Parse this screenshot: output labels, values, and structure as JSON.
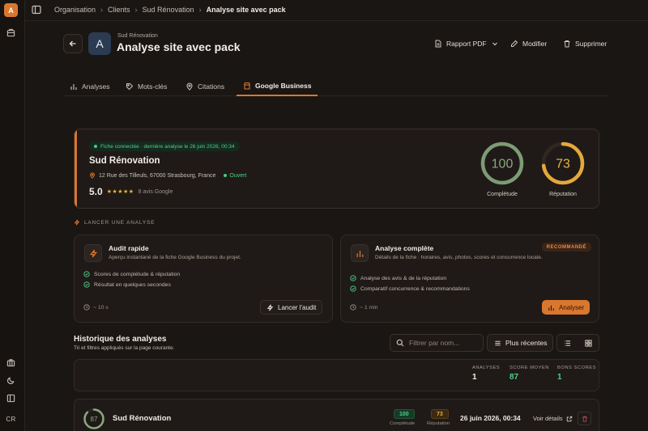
{
  "app": {
    "logo_letter": "A",
    "user_initials": "CR"
  },
  "breadcrumb": {
    "items": [
      "Organisation",
      "Clients",
      "Sud Rénovation",
      "Analyse site avec pack"
    ]
  },
  "header": {
    "avatar_letter": "A",
    "client": "Sud Rénovation",
    "title": "Analyse site avec pack",
    "pdf_label": "Rapport PDF",
    "edit_label": "Modifier",
    "delete_label": "Supprimer"
  },
  "tabs": [
    {
      "label": "Analyses",
      "icon": "bar-chart-icon"
    },
    {
      "label": "Mots-clés",
      "icon": "tag-icon"
    },
    {
      "label": "Citations",
      "icon": "map-pin-icon"
    },
    {
      "label": "Google Business",
      "icon": "store-icon",
      "active": true
    }
  ],
  "business": {
    "status": "Fiche connectée · dernière analyse le 26 juin 2026, 00:34",
    "name": "Sud Rénovation",
    "address": "12 Rue des Tilleuls, 67000 Strasbourg, France",
    "open_status": "Ouvert",
    "rating": "5.0",
    "stars": "★★★★★",
    "reviews": "8 avis Google",
    "completeness": {
      "value": 100,
      "label": "Complétude",
      "color": "#7d9b74"
    },
    "reputation": {
      "value": 73,
      "label": "Réputation",
      "color": "#e5a83a"
    }
  },
  "launch": {
    "section_label": "LANCER UNE ANALYSE",
    "quick": {
      "title": "Audit rapide",
      "desc": "Aperçu instantané de la fiche Google Business du projet.",
      "checks": [
        "Scores de complétude & réputation",
        "Résultat en quelques secondes"
      ],
      "duration": "~ 10 s",
      "button": "Lancer l'audit"
    },
    "full": {
      "title": "Analyse complète",
      "desc": "Détails de la fiche : horaires, avis, photos, scores et concurrence locale.",
      "badge": "RECOMMANDÉ",
      "checks": [
        "Analyse des avis & de la réputation",
        "Comparatif concurrence & recommandations"
      ],
      "duration": "~ 1 min",
      "button": "Analyser"
    }
  },
  "history": {
    "title": "Historique des analyses",
    "subtitle": "Tri et filtres appliqués sur la page courante.",
    "search_placeholder": "Filtrer par nom...",
    "sort_label": "Plus récentes",
    "stats": [
      {
        "label": "ANALYSES",
        "value": "1",
        "color": "#f1ebe6"
      },
      {
        "label": "SCORE MOYEN",
        "value": "87",
        "color": "#4fd08a"
      },
      {
        "label": "BONS SCORES",
        "value": "1",
        "color": "#4fd08a"
      }
    ],
    "rows": [
      {
        "score": 87,
        "name": "Sud Rénovation",
        "completeness": "100",
        "completeness_label": "Complétude",
        "reputation": "73",
        "reputation_label": "Réputation",
        "date": "26 juin 2026, 00:34",
        "details_label": "Voir détails"
      }
    ]
  }
}
